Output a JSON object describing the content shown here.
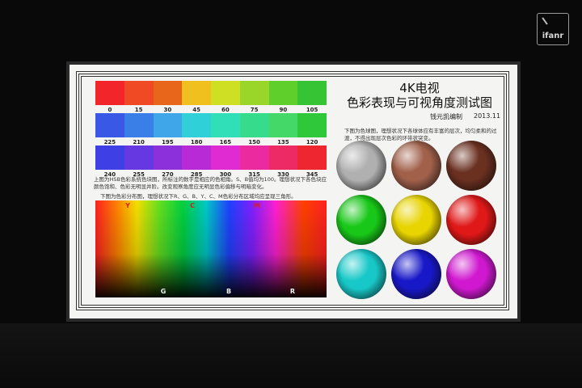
{
  "watermark": {
    "text": "ifanr"
  },
  "chart": {
    "title_line1": "4K电视",
    "title_line2": "色彩表现与可视角度测试图",
    "author": "钱元凯编制",
    "date": "2013.11",
    "row1": {
      "hues": [
        "0",
        "15",
        "30",
        "45",
        "60",
        "75",
        "90",
        "105"
      ],
      "colors": [
        "#f2262a",
        "#ef4a24",
        "#e8661c",
        "#f0c11e",
        "#cfe024",
        "#9ad62a",
        "#5fcf2c",
        "#37c434"
      ]
    },
    "row2": {
      "hues": [
        "225",
        "210",
        "195",
        "180",
        "165",
        "150",
        "135",
        "120"
      ],
      "colors": [
        "#3a58e6",
        "#3a7ee8",
        "#40a6ea",
        "#2fd0d8",
        "#30dfb8",
        "#36dc8c",
        "#44d868",
        "#2fc83a"
      ]
    },
    "row3": {
      "hues": [
        "240",
        "255",
        "270",
        "285",
        "300",
        "315",
        "330",
        "345"
      ],
      "colors": [
        "#3f3fe6",
        "#6638e2",
        "#8c30dc",
        "#b82ad6",
        "#e02ad2",
        "#ea2a9e",
        "#ee2a64",
        "#ee2630"
      ]
    },
    "note_left": "上图为HSB色彩系统色块图，所标注的数字是相应的色相角。S、B值均为100。理想状况下各色块应颜色饱和、色彩无明显并阶。改变观察角度应无明显色彩偏移与明暗变化。",
    "note_spectrum": "下图为色彩分布图，理想状况下R、G、B、Y、C、M色彩分布区域均应呈现三角形。",
    "spectrum_top": [
      {
        "text": "Y",
        "color": "#d42020"
      },
      {
        "text": "C",
        "color": "#d42020"
      },
      {
        "text": "M",
        "color": "#d42020"
      }
    ],
    "spectrum_bottom": [
      {
        "text": "G",
        "color": "#f0f0f0"
      },
      {
        "text": "B",
        "color": "#f0f0f0"
      },
      {
        "text": "R",
        "color": "#f0f0f0"
      }
    ],
    "note_spheres": "下图为色球图，理想状况下各球体应有丰富的层次，均匀柔和的过渡，不得出现层次色彩的环带状突变。",
    "spheres": [
      "#b0b0b0",
      "#a0604a",
      "#6a3020",
      "#18c818",
      "#e8d400",
      "#e01818",
      "#18c8c8",
      "#1818c8",
      "#d018d0"
    ]
  }
}
